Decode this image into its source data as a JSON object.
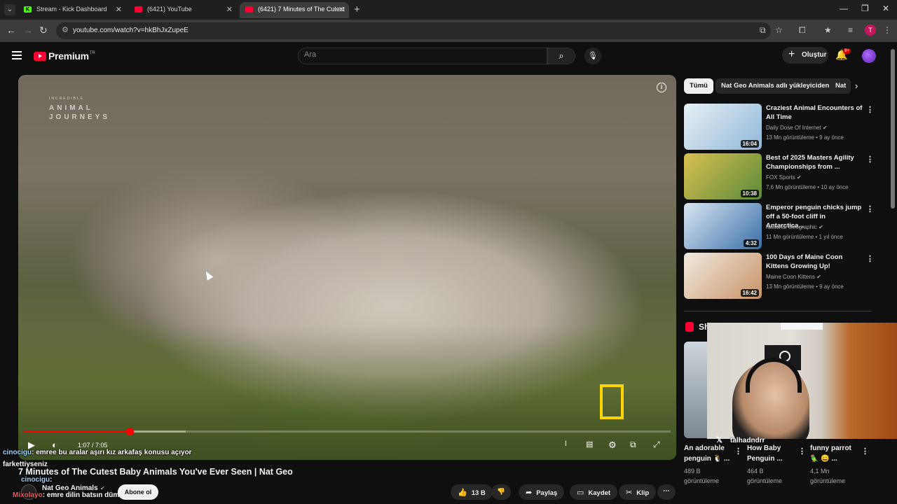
{
  "browser": {
    "tabs": [
      {
        "title": "Stream - Kick Dashboard",
        "icon": "kick-icon"
      },
      {
        "title": "(6421) YouTube",
        "icon": "youtube-icon"
      },
      {
        "title": "(6421) 7 Minutes of The Cutest",
        "icon": "youtube-icon"
      }
    ],
    "url": "youtube.com/watch?v=hkBhJxZupeE",
    "profile_initial": "T"
  },
  "header": {
    "logo_text": "Premium",
    "logo_region": "TR",
    "search_placeholder": "Ara",
    "create_label": "Oluştur",
    "notification_count": "9+"
  },
  "player": {
    "watermark_small": "INCREDIBLE",
    "watermark_line1": "ANIMAL",
    "watermark_line2": "JOURNEYS",
    "time_current": "1:07",
    "time_total": "7:05",
    "progress_played": 0.164,
    "progress_buffered": 0.25
  },
  "chat": [
    {
      "user": "cinocigu",
      "message": ": emree bu aralar aşırı kız arkafaş konusu açıyor"
    },
    {
      "user": "",
      "message": "farkettiysen​iz"
    },
    {
      "user": "cinocigu",
      "message": ":"
    },
    {
      "user": "Mixolayo",
      "message": ": emre dilin batsın dümdüz"
    }
  ],
  "video": {
    "title": "7 Minutes of The Cutest Baby Animals You've Ever Seen | Nat Geo",
    "channel": "Nat Geo Animals",
    "subscribe_label": "Abone ol",
    "likes": "13 B",
    "share_label": "Paylaş",
    "save_label": "Kaydet",
    "clip_label": "Klip"
  },
  "sidebar": {
    "chips": [
      "Tümü",
      "Nat Geo Animals adlı yükleyiciden",
      "Nat"
    ],
    "recommendations": [
      {
        "title": "Craziest Animal Encounters of All Time",
        "channel": "Daily Dose Of Internet",
        "meta": "13 Mn görüntüleme • 9 ay önce",
        "duration": "16:04",
        "colors": [
          "#8fb8d8",
          "#e8f0f5"
        ]
      },
      {
        "title": "Best of 2025 Masters Agility Championships from ...",
        "channel": "FOX Sports",
        "meta": "7,6 Mn görüntüleme • 10 ay önce",
        "duration": "10:38",
        "colors": [
          "#5c8a3a",
          "#d8c050"
        ]
      },
      {
        "title": "Emperor penguin chicks jump off a 50-foot cliff in Antarctica...",
        "channel": "National Geographic",
        "meta": "11 Mn görüntüleme • 1 yıl önce",
        "duration": "4:32",
        "colors": [
          "#3a6fa8",
          "#d9e6f2"
        ]
      },
      {
        "title": "100 Days of Maine Coon Kittens Growing Up!",
        "channel": "Maine Coon Kittens",
        "meta": "13 Mn görüntüleme • 9 ay önce",
        "duration": "16:42",
        "colors": [
          "#c89468",
          "#f1e9df"
        ]
      }
    ],
    "shorts_title": "Shorts",
    "shorts": [
      {
        "title": "An adorable penguin 🐧 ...",
        "meta1": "489 B",
        "meta2": "görüntüleme"
      },
      {
        "title": "How Baby Penguin ...",
        "meta1": "464 B",
        "meta2": "görüntüleme"
      },
      {
        "title": "funny parrot 🦜 😄 ...",
        "meta1": "4,1 Mn",
        "meta2": "görüntüleme"
      }
    ]
  },
  "webcam": {
    "name": "talhadndrr"
  }
}
